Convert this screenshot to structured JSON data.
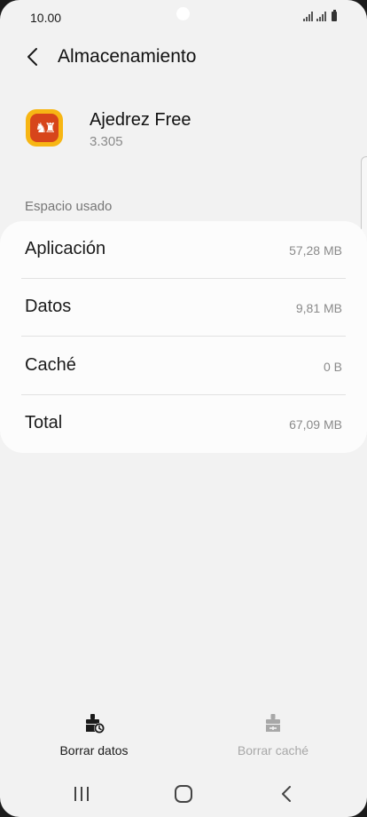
{
  "status_bar": {
    "time": "10.00"
  },
  "app_bar": {
    "title": "Almacenamiento",
    "back_icon": "chevron-left-icon"
  },
  "app": {
    "name": "Ajedrez Free",
    "version": "3.305",
    "icon": "chess-app-icon",
    "icon_colors": {
      "outer": "#f7b614",
      "inner": "#d7451b"
    }
  },
  "storage": {
    "section_label": "Espacio usado",
    "rows": [
      {
        "label": "Aplicación",
        "value": "57,28 MB"
      },
      {
        "label": "Datos",
        "value": "9,81 MB"
      },
      {
        "label": "Caché",
        "value": "0 B"
      },
      {
        "label": "Total",
        "value": "67,09 MB"
      }
    ]
  },
  "actions": {
    "clear_data": {
      "label": "Borrar datos",
      "icon": "clear-data-icon",
      "enabled": true
    },
    "clear_cache": {
      "label": "Borrar caché",
      "icon": "clear-cache-icon",
      "enabled": false
    }
  },
  "nav_bar": {
    "recent_icon": "recent-apps-icon",
    "home_icon": "home-icon",
    "back_icon": "back-icon"
  },
  "colors": {
    "background": "#f2f2f2",
    "card": "#fcfcfc",
    "text_primary": "#1a1a1a",
    "text_secondary": "#8a8a8a",
    "text_disabled": "#a8a8a8"
  }
}
